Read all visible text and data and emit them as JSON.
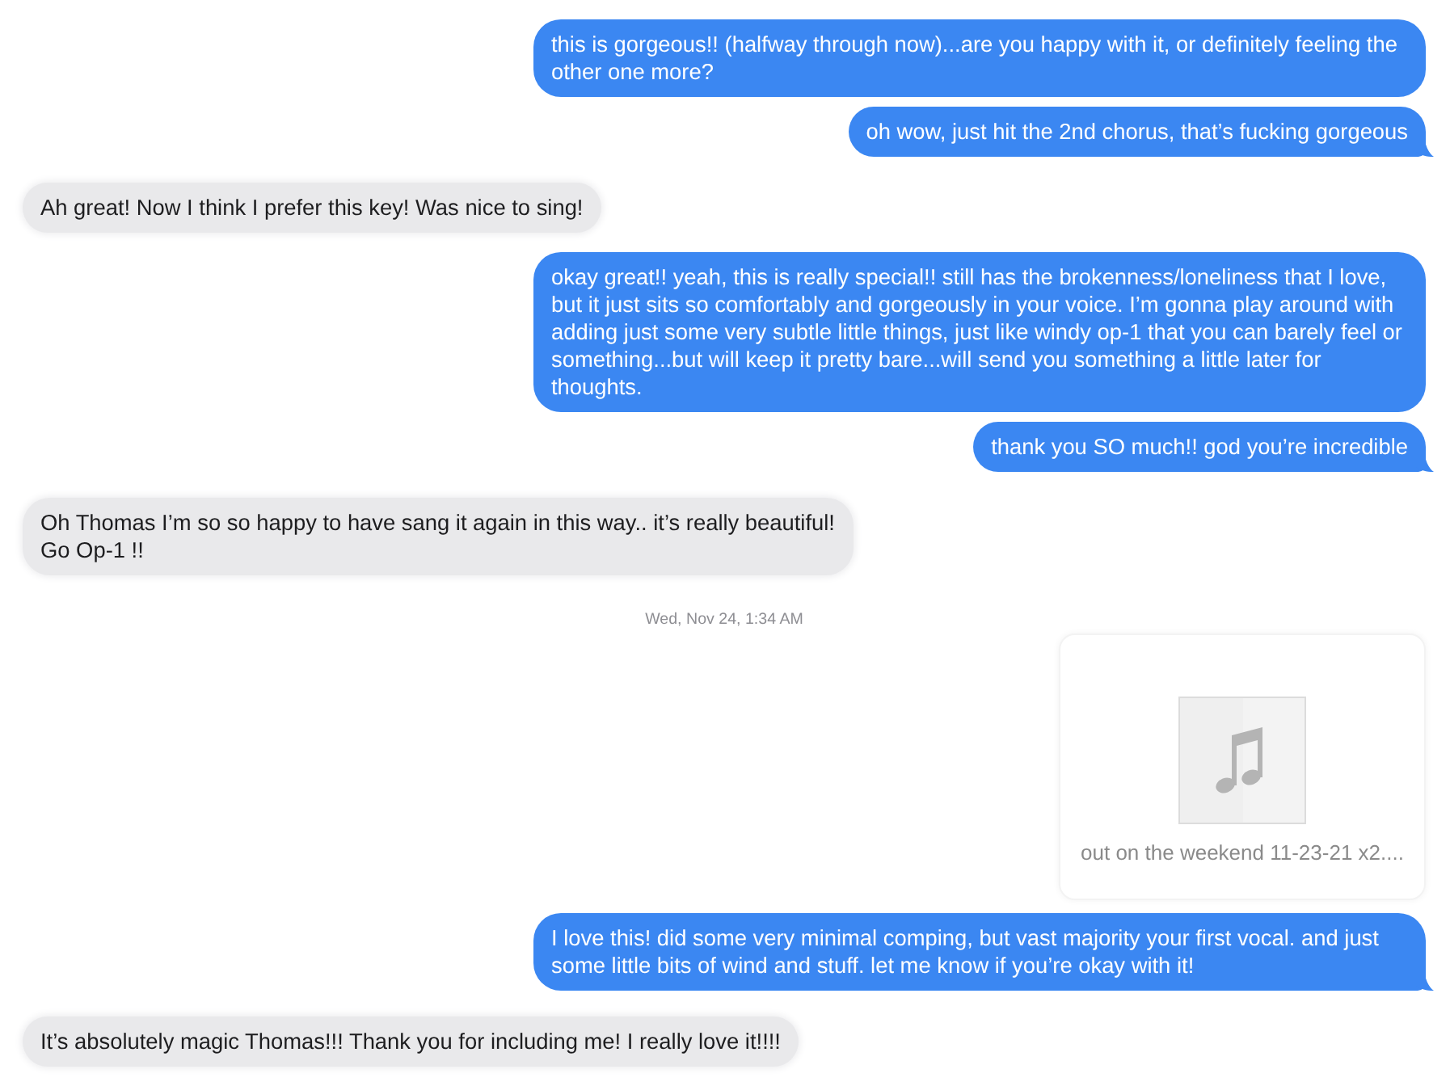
{
  "conversation": {
    "messages": [
      {
        "kind": "sent",
        "text": "this is gorgeous!! (halfway through now)...are you happy with it, or definitely feeling the other one more?",
        "tail": false
      },
      {
        "kind": "sent",
        "text": "oh wow, just hit the 2nd chorus, that’s fucking gorgeous",
        "tail": true
      },
      {
        "kind": "received",
        "text": "Ah great! Now I think I prefer this key! Was nice to sing!",
        "tail": false
      },
      {
        "kind": "sent",
        "text": "okay great!! yeah, this is really special!! still has the brokenness/loneliness that I love, but it just sits so comfortably and gorgeously in your voice. I’m gonna play around with adding just some very subtle little things, just like windy op-1 that you can barely feel or something...but will keep it pretty bare...will send you something a little later for thoughts.",
        "tail": false
      },
      {
        "kind": "sent",
        "text": "thank you SO much!! god you’re incredible",
        "tail": true
      },
      {
        "kind": "received",
        "text": "Oh Thomas I’m so so happy to have sang it again in this way.. it’s really beautiful!\nGo Op-1 !!",
        "tail": false
      },
      {
        "kind": "timestamp",
        "text": "Wed, Nov 24, 1:34 AM"
      },
      {
        "kind": "attachment",
        "filename": "out on the weekend 11-23-21 x2...."
      },
      {
        "kind": "sent",
        "text": "I love this! did some very minimal comping, but vast majority your first vocal. and just some little bits of wind and stuff. let me know if you’re okay with it!",
        "tail": true
      },
      {
        "kind": "received",
        "text": "It’s absolutely magic Thomas!!! Thank you for including me! I really love it!!!!",
        "tail": false
      }
    ]
  }
}
